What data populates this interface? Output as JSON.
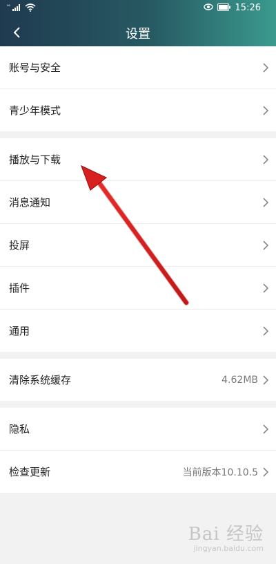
{
  "status_bar": {
    "signal": "⁴⁶",
    "time": "15:26"
  },
  "header": {
    "title": "设置"
  },
  "groups": [
    {
      "items": [
        {
          "label": "账号与安全"
        },
        {
          "label": "青少年模式"
        }
      ]
    },
    {
      "items": [
        {
          "label": "播放与下载"
        },
        {
          "label": "消息通知"
        },
        {
          "label": "投屏"
        },
        {
          "label": "插件"
        },
        {
          "label": "通用"
        }
      ]
    },
    {
      "items": [
        {
          "label": "清除系统缓存",
          "value": "4.62MB"
        }
      ]
    },
    {
      "items": [
        {
          "label": "隐私"
        },
        {
          "label": "检查更新",
          "value": "当前版本10.10.5"
        }
      ]
    }
  ],
  "watermark": {
    "logo": "Bai 经验",
    "url": "jingyan.baidu.com"
  },
  "colors": {
    "header_start": "#1f3a4f",
    "header_end": "#3a9a8e",
    "annotation_arrow": "#d92020"
  }
}
